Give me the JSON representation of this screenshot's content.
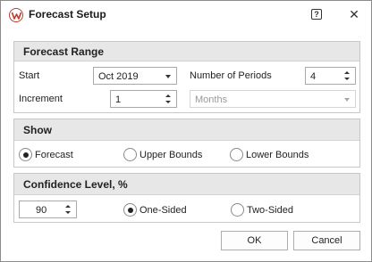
{
  "window": {
    "title": "Forecast Setup",
    "help_icon": "?",
    "close_icon": "✕",
    "app_icon": "weibull-logo-icon"
  },
  "forecast_range": {
    "header": "Forecast Range",
    "start_label": "Start",
    "start_value": "Oct 2019",
    "periods_label": "Number of Periods",
    "periods_value": "4",
    "increment_label": "Increment",
    "increment_value": "1",
    "unit_value": "Months"
  },
  "show": {
    "header": "Show",
    "options": [
      {
        "label": "Forecast",
        "checked": true
      },
      {
        "label": "Upper Bounds",
        "checked": false
      },
      {
        "label": "Lower Bounds",
        "checked": false
      }
    ]
  },
  "confidence": {
    "header": "Confidence Level, %",
    "value": "90",
    "options": [
      {
        "label": "One-Sided",
        "checked": true
      },
      {
        "label": "Two-Sided",
        "checked": false
      }
    ]
  },
  "buttons": {
    "ok": "OK",
    "cancel": "Cancel"
  },
  "colors": {
    "icon_accent": "#c0392b",
    "group_header_bg": "#e7e7e7"
  }
}
